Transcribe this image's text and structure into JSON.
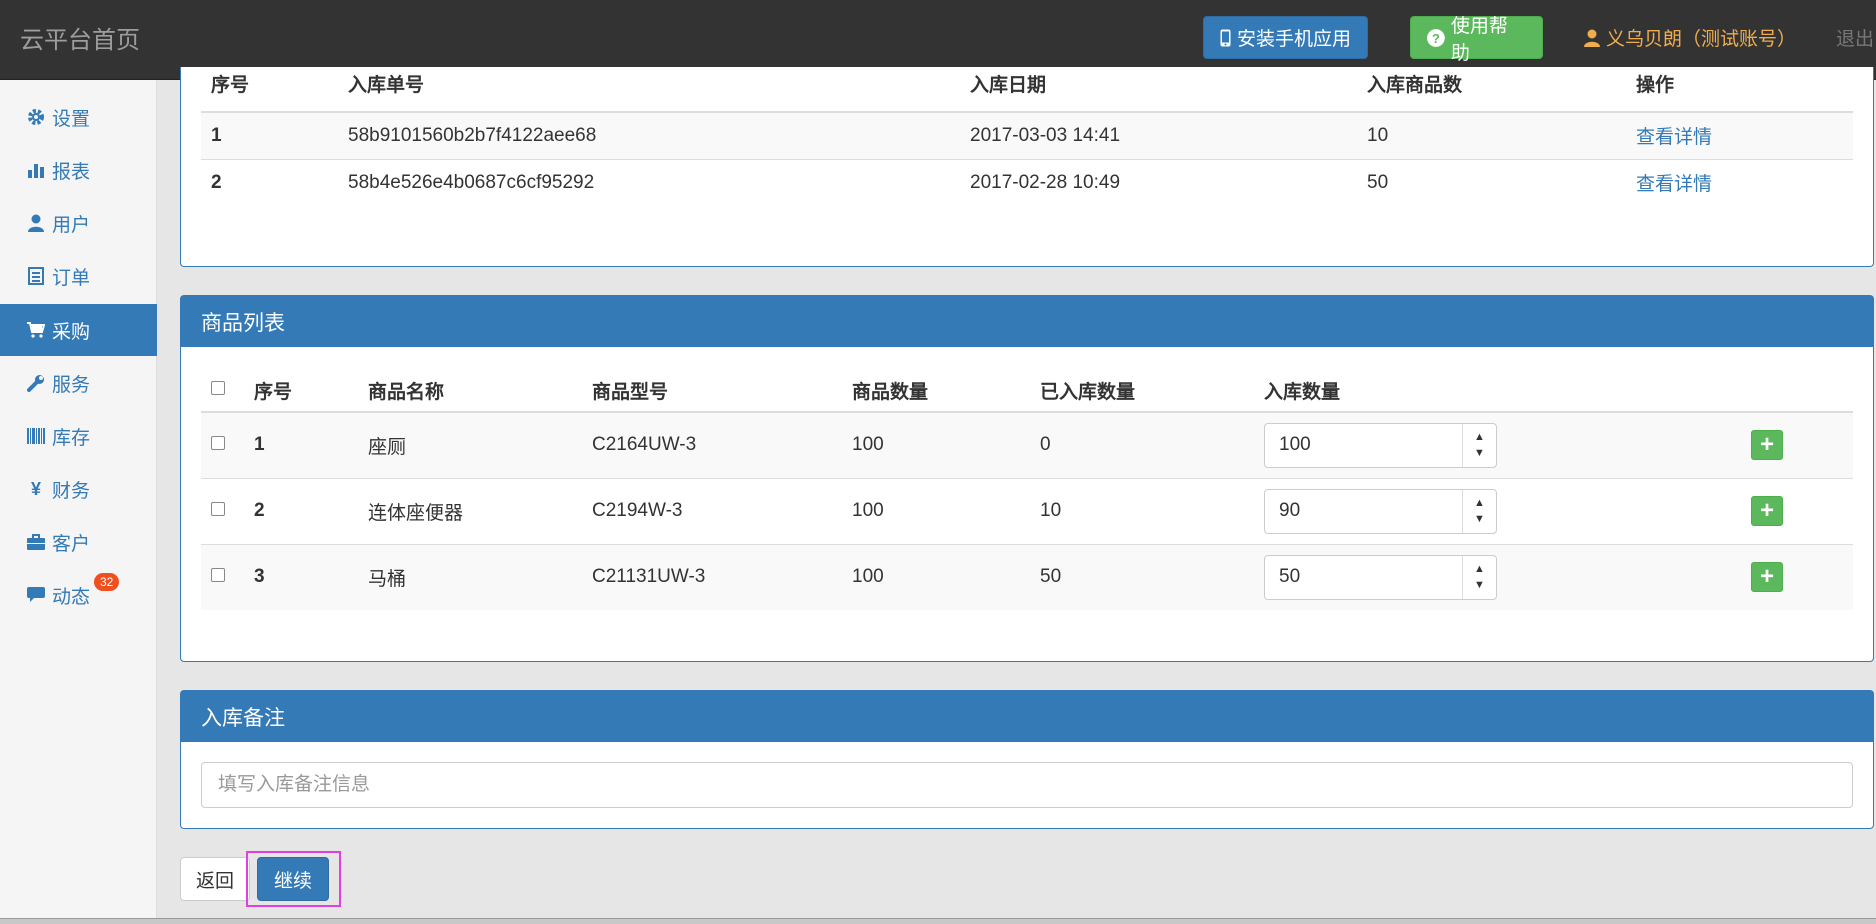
{
  "navbar": {
    "brand": "云平台首页",
    "install_app_label": "安装手机应用",
    "help_label": "使用帮助",
    "user_label": "义乌贝朗（测试账号）",
    "logout_label": "退出"
  },
  "sidebar": {
    "items": [
      {
        "label": "设置",
        "icon": "gear-icon"
      },
      {
        "label": "报表",
        "icon": "bar-chart-icon"
      },
      {
        "label": "用户",
        "icon": "user-icon"
      },
      {
        "label": "订单",
        "icon": "list-icon"
      },
      {
        "label": "采购",
        "icon": "cart-icon",
        "active": true
      },
      {
        "label": "服务",
        "icon": "wrench-icon"
      },
      {
        "label": "库存",
        "icon": "barcode-icon"
      },
      {
        "label": "财务",
        "icon": "yen-icon"
      },
      {
        "label": "客户",
        "icon": "briefcase-icon"
      },
      {
        "label": "动态",
        "icon": "comment-icon",
        "badge": "32"
      }
    ]
  },
  "inbound_records": {
    "headers": [
      "序号",
      "入库单号",
      "入库日期",
      "入库商品数",
      "操作"
    ],
    "rows": [
      {
        "index": "1",
        "order_no": "58b9101560b2b7f4122aee68",
        "date": "2017-03-03 14:41",
        "count": "10",
        "action": "查看详情"
      },
      {
        "index": "2",
        "order_no": "58b4e526e4b0687c6cf95292",
        "date": "2017-02-28 10:49",
        "count": "50",
        "action": "查看详情"
      }
    ]
  },
  "product_list": {
    "title": "商品列表",
    "headers": [
      "序号",
      "商品名称",
      "商品型号",
      "商品数量",
      "已入库数量",
      "入库数量"
    ],
    "rows": [
      {
        "index": "1",
        "name": "座厕",
        "model": "C2164UW-3",
        "quantity": "100",
        "received": "0",
        "inbound_qty": "100"
      },
      {
        "index": "2",
        "name": "连体座便器",
        "model": "C2194W-3",
        "quantity": "100",
        "received": "10",
        "inbound_qty": "90"
      },
      {
        "index": "3",
        "name": "马桶",
        "model": "C21131UW-3",
        "quantity": "100",
        "received": "50",
        "inbound_qty": "50"
      }
    ]
  },
  "remark": {
    "title": "入库备注",
    "placeholder": "填写入库备注信息"
  },
  "actions": {
    "back_label": "返回",
    "continue_label": "继续"
  },
  "colors": {
    "primary": "#337ab7",
    "success": "#5cb85c",
    "warning": "#f0ad4e",
    "navbar": "#333333",
    "highlight": "#e040e0"
  }
}
